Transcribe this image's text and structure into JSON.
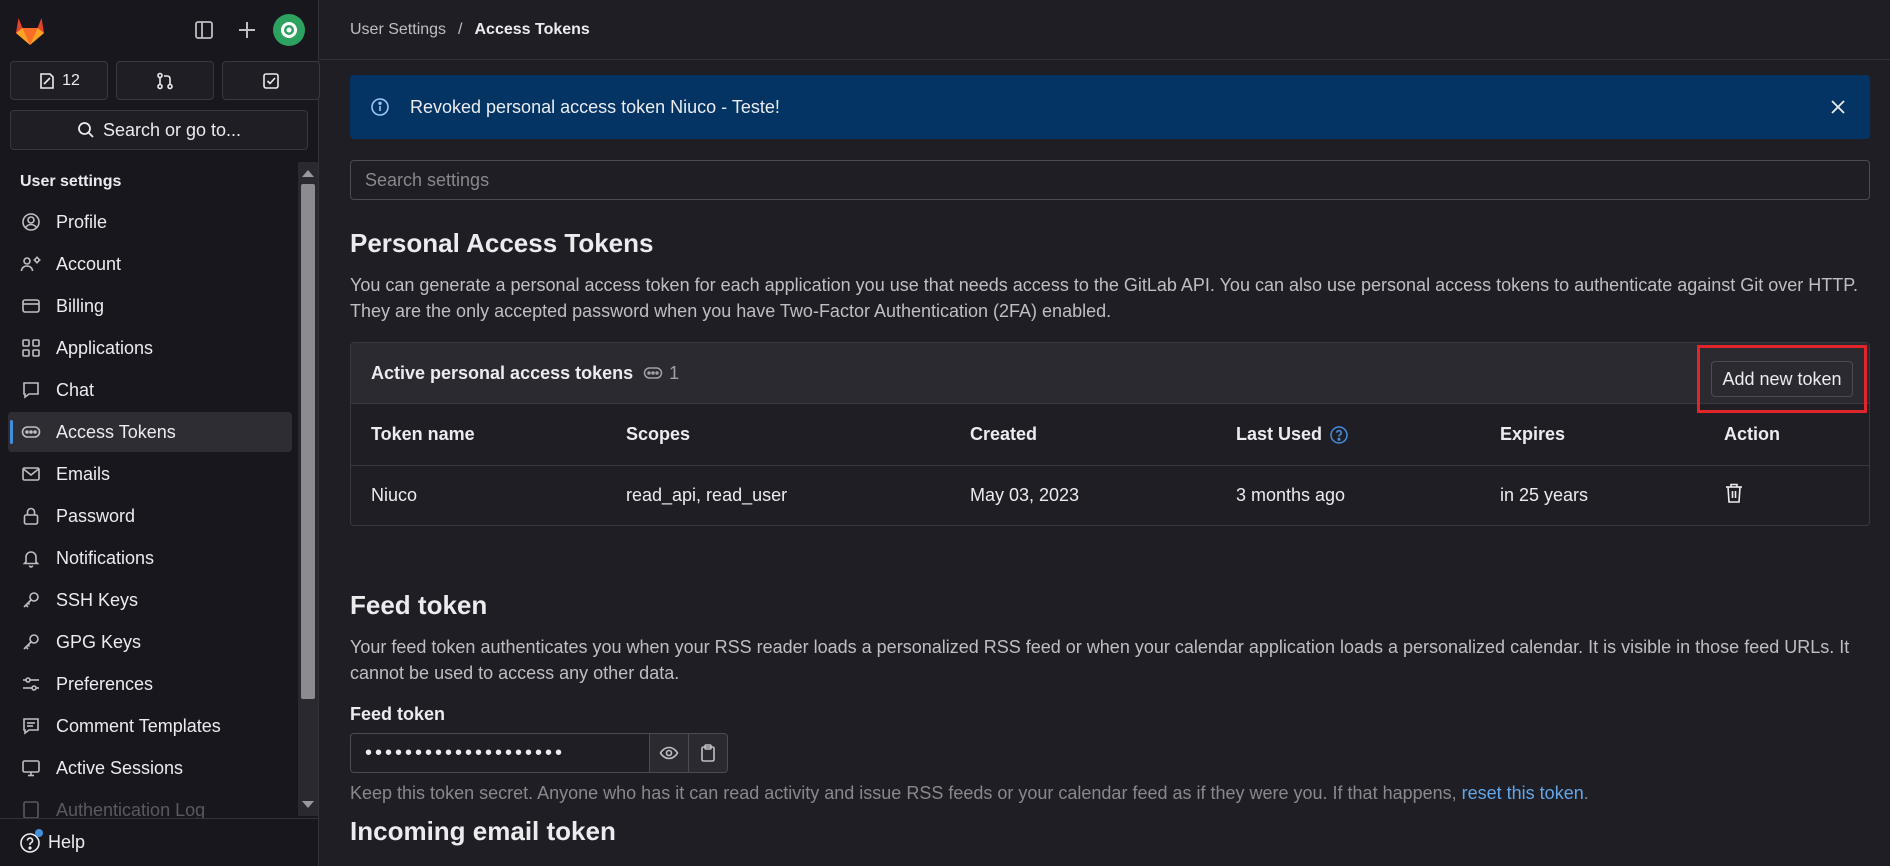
{
  "sidebar": {
    "counters": [
      {
        "icon": "issues-icon",
        "count": "12"
      },
      {
        "icon": "merge-request-icon",
        "count": ""
      },
      {
        "icon": "todo-icon",
        "count": ""
      }
    ],
    "search_label": "Search or go to...",
    "section_title": "User settings",
    "items": [
      {
        "label": "Profile",
        "icon": "profile-icon"
      },
      {
        "label": "Account",
        "icon": "account-icon"
      },
      {
        "label": "Billing",
        "icon": "billing-icon"
      },
      {
        "label": "Applications",
        "icon": "applications-icon"
      },
      {
        "label": "Chat",
        "icon": "chat-icon"
      },
      {
        "label": "Access Tokens",
        "icon": "token-icon",
        "active": true
      },
      {
        "label": "Emails",
        "icon": "email-icon"
      },
      {
        "label": "Password",
        "icon": "lock-icon"
      },
      {
        "label": "Notifications",
        "icon": "bell-icon"
      },
      {
        "label": "SSH Keys",
        "icon": "key-icon"
      },
      {
        "label": "GPG Keys",
        "icon": "key-icon"
      },
      {
        "label": "Preferences",
        "icon": "preferences-icon"
      },
      {
        "label": "Comment Templates",
        "icon": "comment-icon"
      },
      {
        "label": "Active Sessions",
        "icon": "monitor-icon"
      },
      {
        "label": "Authentication Log",
        "icon": "log-icon"
      }
    ],
    "help_label": "Help"
  },
  "breadcrumb": {
    "parent": "User Settings",
    "separator": "/",
    "current": "Access Tokens"
  },
  "alert": {
    "message": "Revoked personal access token Niuco - Teste!"
  },
  "search": {
    "placeholder": "Search settings"
  },
  "pat": {
    "title": "Personal Access Tokens",
    "description": "You can generate a personal access token for each application you use that needs access to the GitLab API. You can also use personal access tokens to authenticate against Git over HTTP. They are the only accepted password when you have Two-Factor Authentication (2FA) enabled.",
    "card_title": "Active personal access tokens",
    "card_count": "1",
    "add_button": "Add new token",
    "columns": [
      "Token name",
      "Scopes",
      "Created",
      "Last Used",
      "Expires",
      "Action"
    ],
    "rows": [
      {
        "name": "Niuco",
        "scopes": "read_api, read_user",
        "created": "May 03, 2023",
        "last_used": "3 months ago",
        "expires": "in 25 years"
      }
    ]
  },
  "feed": {
    "title": "Feed token",
    "description": "Your feed token authenticates you when your RSS reader loads a personalized RSS feed or when your calendar application loads a personalized calendar. It is visible in those feed URLs. It cannot be used to access any other data.",
    "label": "Feed token",
    "value": "••••••••••••••••••••",
    "hint_text": "Keep this token secret. Anyone who has it can read activity and issue RSS feeds or your calendar feed as if they were you. If that happens,",
    "hint_link": "reset this token",
    "hint_end": "."
  },
  "incoming": {
    "title": "Incoming email token"
  },
  "colors": {
    "accent": "#428fdc",
    "alert_bg": "#033464",
    "highlight": "#e0262b",
    "avatar": "#2da160"
  }
}
